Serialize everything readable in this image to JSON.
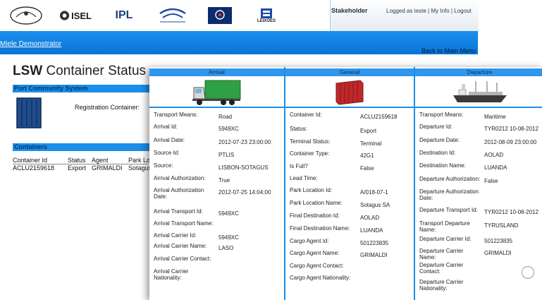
{
  "header": {
    "logos": [
      "MIELE",
      "ISEL",
      "IPL",
      "LEIXÕES"
    ],
    "stakeholder": "Stakeholder",
    "logged_as": "Logged as teste",
    "my_info": "My Info",
    "logout": "Logout",
    "separator": "|"
  },
  "banner": {
    "title": "Miele Demonstrator",
    "back_link": "Back to Main Menu"
  },
  "page": {
    "title_prefix": "LSW",
    "title_rest": "Container Status",
    "section_pcs": "Port Community System",
    "registration_label": "Registration Container:",
    "section_containers": "Containers",
    "columns": [
      "Container Id",
      "Status",
      "Agent",
      "Park Lo"
    ],
    "row": [
      "ACLU2159618",
      "Export",
      "GRIMALDI",
      "Sotagus"
    ]
  },
  "arrival": {
    "title": "Arrival",
    "labels": [
      "Transport Means:",
      "Arrival Id:",
      "Arrival Date:",
      "Source Id:",
      "Source:",
      "Arrival Authorization:",
      "Arrival Authorization Date:",
      "Arrival Transport Id:",
      "Arrival Transport Name:",
      "Arrival Carrier Id:",
      "Arrival Carrier Name:",
      "Arrival Carrier Contact:",
      "Arrival Carrier Nationality:"
    ],
    "values": [
      "Road",
      "5949XC",
      "2012-07-23 23:00:00",
      "PTLIS",
      "LISBON-SOTAGUS",
      "True",
      "2012-07-25 14:04:00",
      "5949XC",
      "",
      "5949XC",
      "LASO",
      "",
      ""
    ]
  },
  "general": {
    "title": "General",
    "labels": [
      "Container Id:",
      "Status:",
      "Terminal Status:",
      "Container Type:",
      "Is Full?",
      "Lead Time:",
      "Park Location Id:",
      "Park Location Name:",
      "Final Destination Id:",
      "Final Destination Name:",
      "Cargo Agent Id:",
      "Cargo Agent Name:",
      "Cargo Agent Contact:",
      "Cargo Agent Nationality:"
    ],
    "values": [
      "ACLU2159618",
      "Export",
      "Terminal",
      "42G1",
      "False",
      "",
      "A/018-07-1",
      "Sotagus SA",
      "AOLAD",
      "LUANDA",
      "501223835",
      "GRIMALDI",
      "",
      ""
    ]
  },
  "departure": {
    "title": "Departure",
    "labels": [
      "Transport Means:",
      "Departure Id:",
      "Departure Date:",
      "Destination Id:",
      "Destination Name:",
      "Departure Authorization:",
      "Departure Authorization Date:",
      "Departure Transport Id:",
      "Transport Departure Name:",
      "Departure Carrier Id:",
      "Departure Carrier Name:",
      "Departure Carrier Contact:",
      "Departure Carrier Nationality:"
    ],
    "values": [
      "Maritime",
      "TYR0212 10-08-2012",
      "2012-08-09 23:00:00",
      "AOLAD",
      "LUANDA",
      "False",
      "",
      "TYR0212 10-08-2012",
      "TYRUSLAND",
      "501223835",
      "GRIMALDI",
      "",
      ""
    ]
  },
  "colors": {
    "brand_blue": "#1a8eeb",
    "header_blue": "#0a74d6",
    "truck_green": "#2fa043",
    "container_red": "#c0282a"
  }
}
